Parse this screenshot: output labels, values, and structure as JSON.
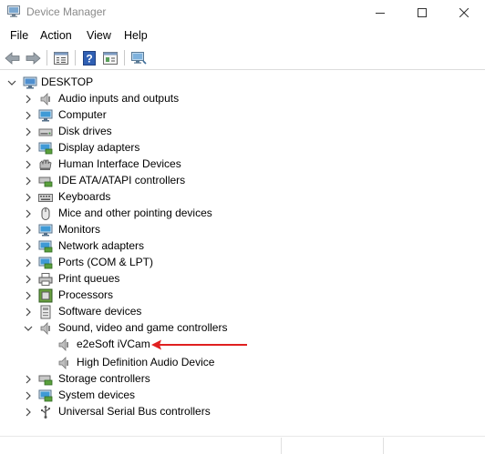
{
  "window": {
    "title": "Device Manager",
    "minimize_icon": "minimize-icon",
    "maximize_icon": "maximize-icon",
    "close_icon": "close-icon"
  },
  "menu": {
    "items": [
      "File",
      "Action",
      "View",
      "Help"
    ]
  },
  "toolbar": {
    "icons": [
      "back-arrow-icon",
      "forward-arrow-icon",
      "properties-icon",
      "help-icon",
      "driver-details-icon",
      "scan-hardware-icon"
    ]
  },
  "tree": {
    "root": "DESKTOP",
    "categories": [
      {
        "label": "Audio inputs and outputs",
        "icon": "speaker-icon"
      },
      {
        "label": "Computer",
        "icon": "computer-icon"
      },
      {
        "label": "Disk drives",
        "icon": "disk-drive-icon"
      },
      {
        "label": "Display adapters",
        "icon": "display-adapter-icon"
      },
      {
        "label": "Human Interface Devices",
        "icon": "hid-icon"
      },
      {
        "label": "IDE ATA/ATAPI controllers",
        "icon": "ide-controller-icon"
      },
      {
        "label": "Keyboards",
        "icon": "keyboard-icon"
      },
      {
        "label": "Mice and other pointing devices",
        "icon": "mouse-icon"
      },
      {
        "label": "Monitors",
        "icon": "monitor-icon"
      },
      {
        "label": "Network adapters",
        "icon": "network-adapter-icon"
      },
      {
        "label": "Ports (COM & LPT)",
        "icon": "port-icon"
      },
      {
        "label": "Print queues",
        "icon": "printer-icon"
      },
      {
        "label": "Processors",
        "icon": "processor-icon"
      },
      {
        "label": "Software devices",
        "icon": "software-device-icon"
      },
      {
        "label": "Sound, video and game controllers",
        "icon": "speaker-icon",
        "expanded": true,
        "children": [
          {
            "label": "e2eSoft iVCam",
            "icon": "speaker-icon"
          },
          {
            "label": "High Definition Audio Device",
            "icon": "speaker-icon"
          }
        ]
      },
      {
        "label": "Storage controllers",
        "icon": "storage-controller-icon"
      },
      {
        "label": "System devices",
        "icon": "system-device-icon"
      },
      {
        "label": "Universal Serial Bus controllers",
        "icon": "usb-icon"
      }
    ]
  },
  "annotation": {
    "arrow_color": "#e02020",
    "arrow_icon": "red-arrow-icon"
  }
}
